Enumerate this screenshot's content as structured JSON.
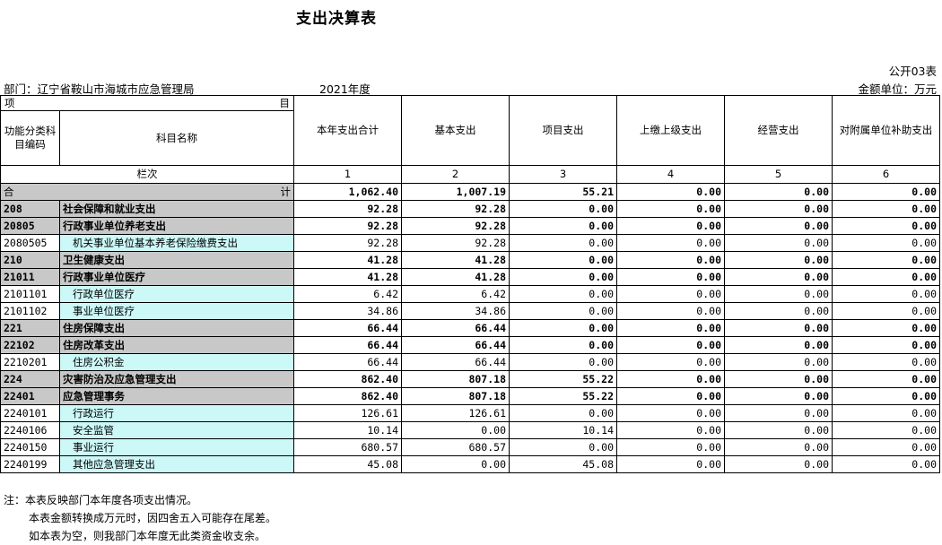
{
  "title": "支出决算表",
  "form_no": "公开03表",
  "department": "部门：辽宁省鞍山市海城市应急管理局",
  "year": "2021年度",
  "unit": "金额单位：万元",
  "header": {
    "xiang": "项",
    "mu": "目",
    "code_label": "功能分类科目编码",
    "name_label": "科目名称",
    "cols": [
      "本年支出合计",
      "基本支出",
      "项目支出",
      "上缴上级支出",
      "经营支出",
      "对附属单位补助支出"
    ],
    "lanci": "栏次",
    "col_nums": [
      "1",
      "2",
      "3",
      "4",
      "5",
      "6"
    ]
  },
  "total": {
    "label_left": "合",
    "label_right": "计",
    "values": [
      "1,062.40",
      "1,007.19",
      "55.21",
      "0.00",
      "0.00",
      "0.00"
    ]
  },
  "rows": [
    {
      "code": "208",
      "name": "社会保障和就业支出",
      "values": [
        "92.28",
        "92.28",
        "0.00",
        "0.00",
        "0.00",
        "0.00"
      ],
      "level": "bold"
    },
    {
      "code": "20805",
      "name": "行政事业单位养老支出",
      "values": [
        "92.28",
        "92.28",
        "0.00",
        "0.00",
        "0.00",
        "0.00"
      ],
      "level": "bold"
    },
    {
      "code": "2080505",
      "name": "机关事业单位基本养老保险缴费支出",
      "values": [
        "92.28",
        "92.28",
        "0.00",
        "0.00",
        "0.00",
        "0.00"
      ],
      "level": "leaf"
    },
    {
      "code": "210",
      "name": "卫生健康支出",
      "values": [
        "41.28",
        "41.28",
        "0.00",
        "0.00",
        "0.00",
        "0.00"
      ],
      "level": "bold"
    },
    {
      "code": "21011",
      "name": "行政事业单位医疗",
      "values": [
        "41.28",
        "41.28",
        "0.00",
        "0.00",
        "0.00",
        "0.00"
      ],
      "level": "bold"
    },
    {
      "code": "2101101",
      "name": "行政单位医疗",
      "values": [
        "6.42",
        "6.42",
        "0.00",
        "0.00",
        "0.00",
        "0.00"
      ],
      "level": "leaf"
    },
    {
      "code": "2101102",
      "name": "事业单位医疗",
      "values": [
        "34.86",
        "34.86",
        "0.00",
        "0.00",
        "0.00",
        "0.00"
      ],
      "level": "leaf"
    },
    {
      "code": "221",
      "name": "住房保障支出",
      "values": [
        "66.44",
        "66.44",
        "0.00",
        "0.00",
        "0.00",
        "0.00"
      ],
      "level": "bold"
    },
    {
      "code": "22102",
      "name": "住房改革支出",
      "values": [
        "66.44",
        "66.44",
        "0.00",
        "0.00",
        "0.00",
        "0.00"
      ],
      "level": "bold"
    },
    {
      "code": "2210201",
      "name": "住房公积金",
      "values": [
        "66.44",
        "66.44",
        "0.00",
        "0.00",
        "0.00",
        "0.00"
      ],
      "level": "leaf"
    },
    {
      "code": "224",
      "name": "灾害防治及应急管理支出",
      "values": [
        "862.40",
        "807.18",
        "55.22",
        "0.00",
        "0.00",
        "0.00"
      ],
      "level": "bold"
    },
    {
      "code": "22401",
      "name": "应急管理事务",
      "values": [
        "862.40",
        "807.18",
        "55.22",
        "0.00",
        "0.00",
        "0.00"
      ],
      "level": "bold"
    },
    {
      "code": "2240101",
      "name": "行政运行",
      "values": [
        "126.61",
        "126.61",
        "0.00",
        "0.00",
        "0.00",
        "0.00"
      ],
      "level": "leaf"
    },
    {
      "code": "2240106",
      "name": "安全监管",
      "values": [
        "10.14",
        "0.00",
        "10.14",
        "0.00",
        "0.00",
        "0.00"
      ],
      "level": "leaf"
    },
    {
      "code": "2240150",
      "name": "事业运行",
      "values": [
        "680.57",
        "680.57",
        "0.00",
        "0.00",
        "0.00",
        "0.00"
      ],
      "level": "leaf"
    },
    {
      "code": "2240199",
      "name": "其他应急管理支出",
      "values": [
        "45.08",
        "0.00",
        "45.08",
        "0.00",
        "0.00",
        "0.00"
      ],
      "level": "leaf"
    }
  ],
  "notes": [
    "注：本表反映部门本年度各项支出情况。",
    "本表金额转换成万元时，因四舍五入可能存在尾差。",
    "如本表为空，则我部门本年度无此类资金收支余。"
  ]
}
